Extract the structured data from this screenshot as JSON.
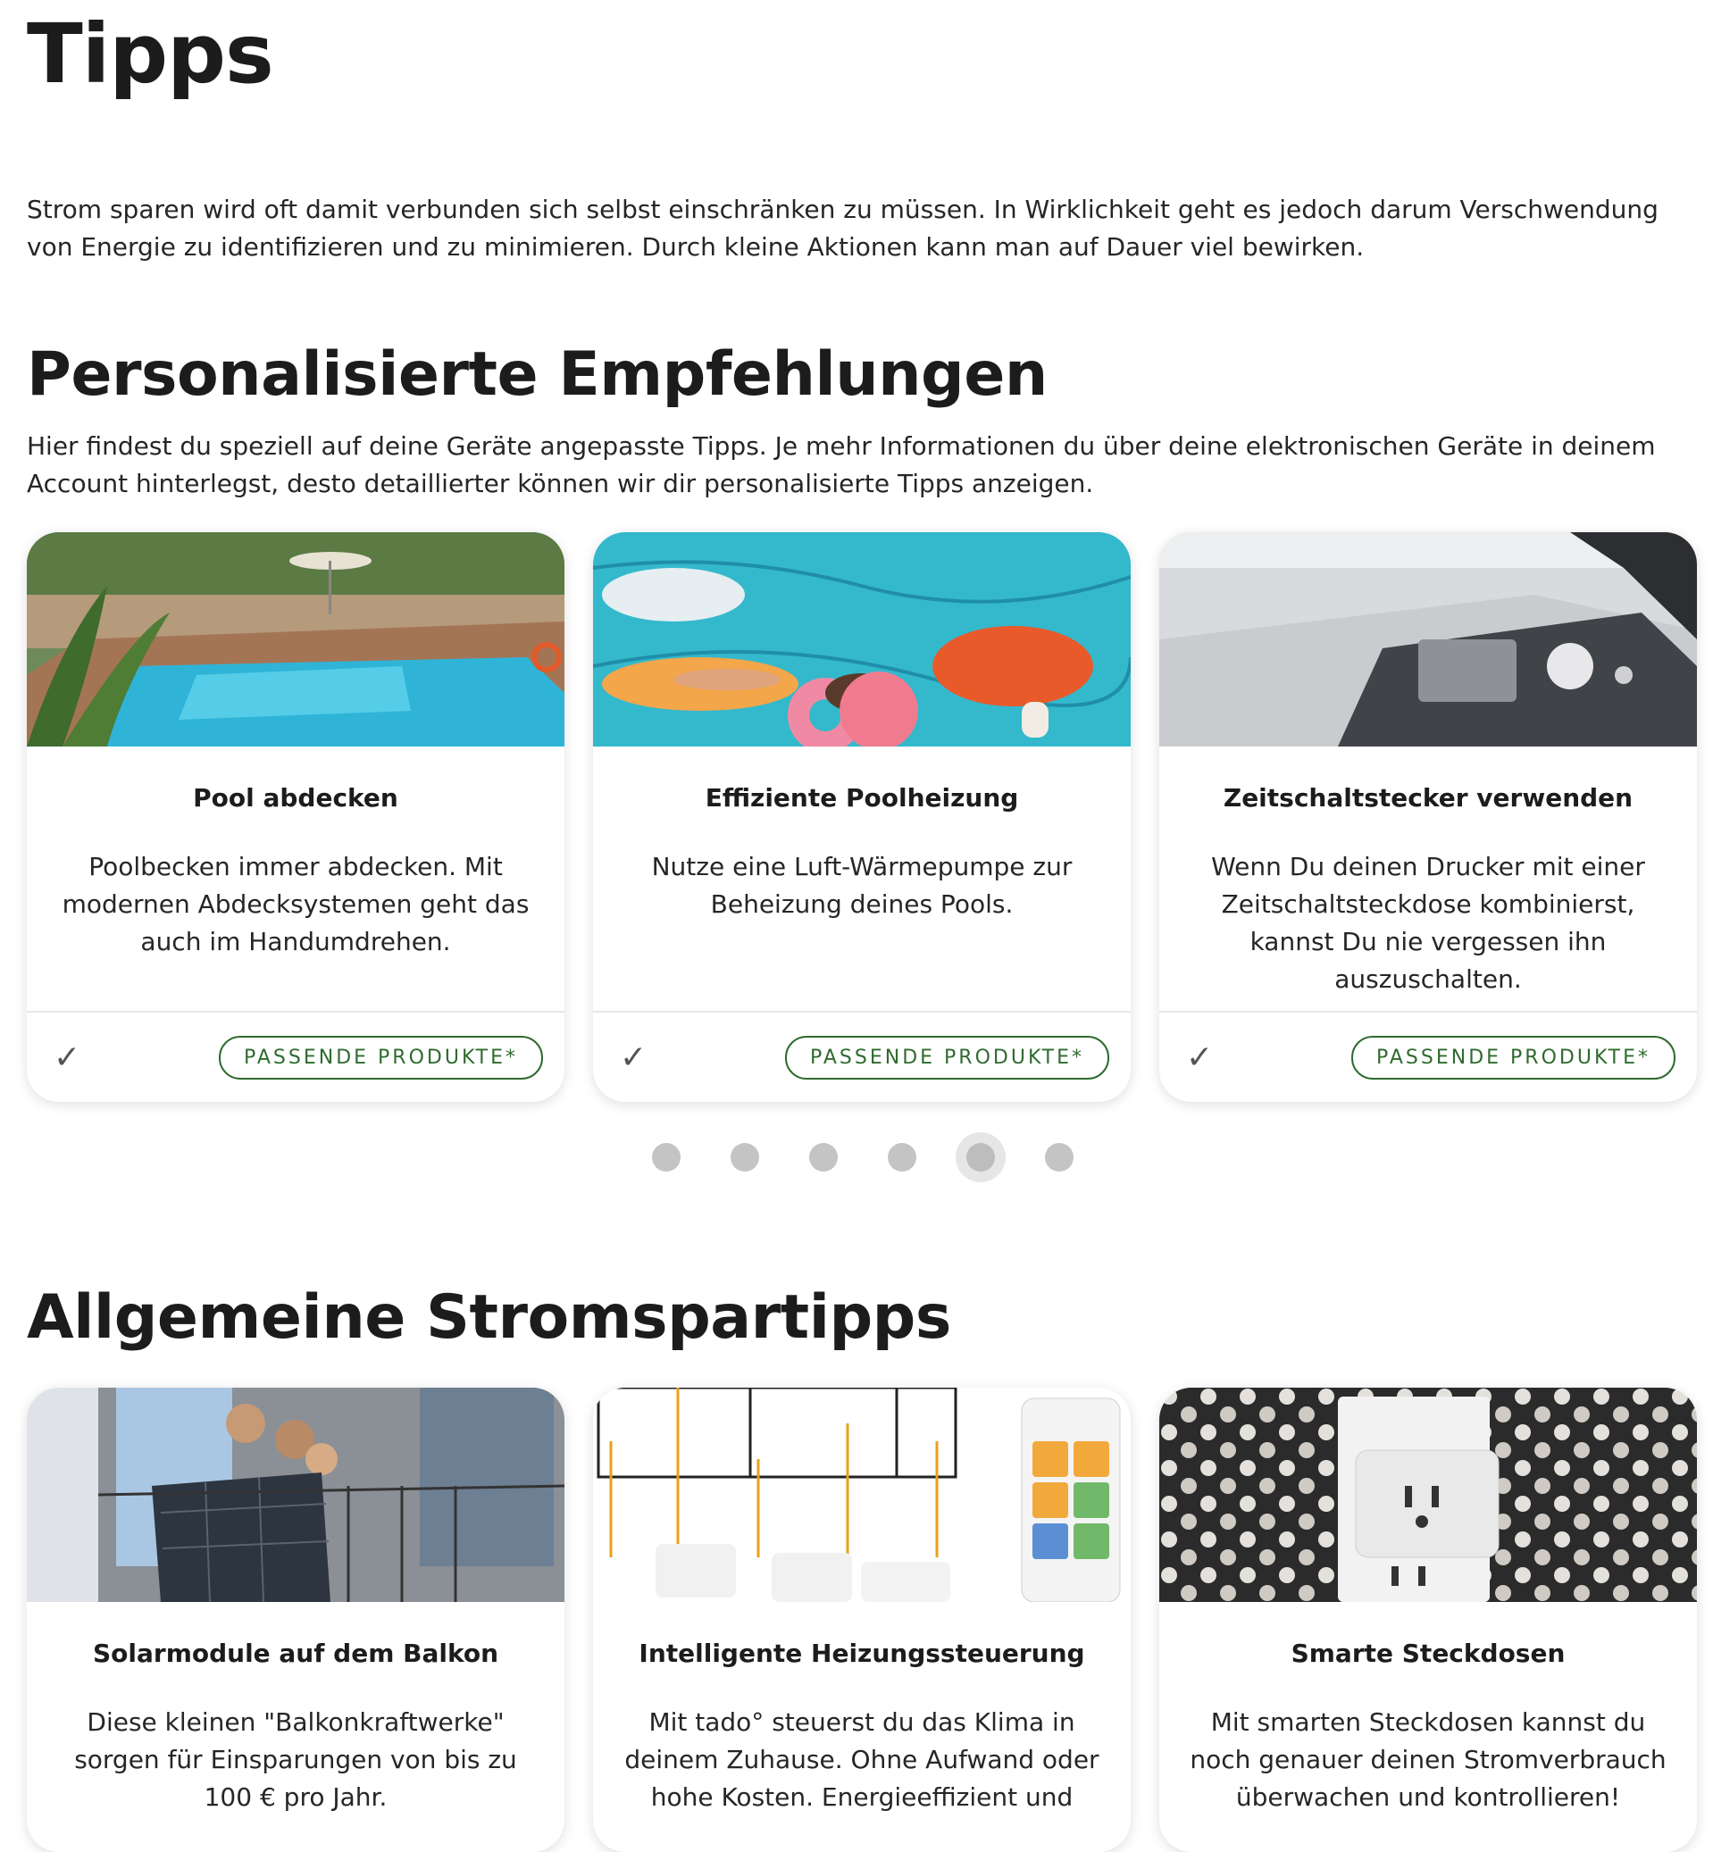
{
  "page": {
    "title": "Tipps",
    "intro": "Strom sparen wird oft damit verbunden sich selbst einschränken zu müssen. In Wirklichkeit geht es jedoch darum Verschwendung von Energie zu identifizieren und zu minimieren. Durch kleine Aktionen kann man auf Dauer viel bewirken."
  },
  "personalized": {
    "title": "Personalisierte Empfehlungen",
    "description": "Hier findest du speziell auf deine Geräte angepasste Tipps. Je mehr Informationen du über deine elektronischen Geräte in deinem Account hinterlegst, desto detaillierter können wir dir personalisierte Tipps anzeigen.",
    "cards": [
      {
        "title": "Pool abdecken",
        "text": "Poolbecken immer abdecken. Mit modernen Abdecksystemen geht das auch im Handumdrehen.",
        "button": "PASSENDE PRODUKTE*",
        "image": "pool-garden-photo"
      },
      {
        "title": "Effiziente Poolheizung",
        "text": "Nutze eine Luft-Wärmepumpe zur Beheizung deines Pools.",
        "button": "PASSENDE PRODUKTE*",
        "image": "pool-floats-photo"
      },
      {
        "title": "Zeitschaltstecker verwenden",
        "text": "Wenn Du deinen Drucker mit einer Zeitschaltsteckdose kombinierst, kannst Du nie vergessen ihn auszuschalten.",
        "button": "PASSENDE PRODUKTE*",
        "image": "printer-photo"
      }
    ],
    "carousel": {
      "count": 6,
      "active_index": 4
    }
  },
  "general": {
    "title": "Allgemeine Stromspartipps",
    "cards": [
      {
        "title": "Solarmodule auf dem Balkon",
        "text": "Diese kleinen \"Balkonkraftwerke\" sorgen für Einsparungen von bis zu 100 € pro Jahr.",
        "image": "balcony-solar-photo"
      },
      {
        "title": "Intelligente Heizungssteuerung",
        "text": "Mit tado° steuerst du das Klima in deinem Zuhause. Ohne Aufwand oder hohe Kosten. Energieeffizient und",
        "image": "heating-control-illustration"
      },
      {
        "title": "Smarte Steckdosen",
        "text": "Mit smarten Steckdosen kannst du noch genauer deinen Stromverbrauch überwachen und kontrollieren!",
        "image": "smart-plug-photo"
      }
    ]
  },
  "colors": {
    "accent": "#2f6b2f",
    "text": "#1c1c1c",
    "dot": "#c4c4c4"
  },
  "icons": {
    "done": "check-icon"
  }
}
